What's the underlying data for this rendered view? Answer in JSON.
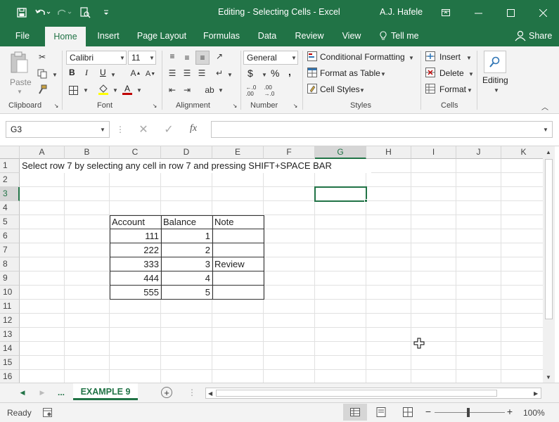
{
  "window": {
    "title": "Editing - Selecting Cells  -  Excel",
    "user": "A.J. Hafele"
  },
  "ribbon_tabs": [
    "File",
    "Home",
    "Insert",
    "Page Layout",
    "Formulas",
    "Data",
    "Review",
    "View",
    "Tell me",
    "Share"
  ],
  "ribbon": {
    "clipboard": {
      "paste": "Paste",
      "label": "Clipboard"
    },
    "font": {
      "name": "Calibri",
      "size": "11",
      "bold": "B",
      "italic": "I",
      "underline": "U",
      "label": "Font"
    },
    "alignment": {
      "label": "Alignment"
    },
    "number": {
      "format": "General",
      "currency": "$",
      "percent": "%",
      "comma": ",",
      "label": "Number"
    },
    "styles": {
      "conditional": "Conditional Formatting",
      "format_table": "Format as Table",
      "cell_styles": "Cell Styles",
      "label": "Styles"
    },
    "cells": {
      "insert": "Insert",
      "delete": "Delete",
      "format": "Format",
      "label": "Cells"
    },
    "editing": {
      "label": "Editing"
    }
  },
  "formula_bar": {
    "name_box": "G3",
    "fx": "fx",
    "value": ""
  },
  "columns": [
    "A",
    "B",
    "C",
    "D",
    "E",
    "F",
    "G",
    "H",
    "I",
    "J",
    "K"
  ],
  "rows": [
    "1",
    "2",
    "3",
    "4",
    "5",
    "6",
    "7",
    "8",
    "9",
    "10",
    "11",
    "12",
    "13",
    "14",
    "15",
    "16"
  ],
  "sheet": {
    "instruction": "Select row 7 by selecting any cell in row 7 and pressing SHIFT+SPACE BAR",
    "table_headers": [
      "Account",
      "Balance",
      "Note"
    ],
    "table_rows": [
      [
        "111",
        "1",
        ""
      ],
      [
        "222",
        "2",
        ""
      ],
      [
        "333",
        "3",
        "Review"
      ],
      [
        "444",
        "4",
        ""
      ],
      [
        "555",
        "5",
        ""
      ]
    ]
  },
  "sheet_tabs": {
    "more": "...",
    "active": "EXAMPLE 9"
  },
  "status": {
    "ready": "Ready",
    "zoom": "100%"
  },
  "colors": {
    "accent": "#217346"
  }
}
